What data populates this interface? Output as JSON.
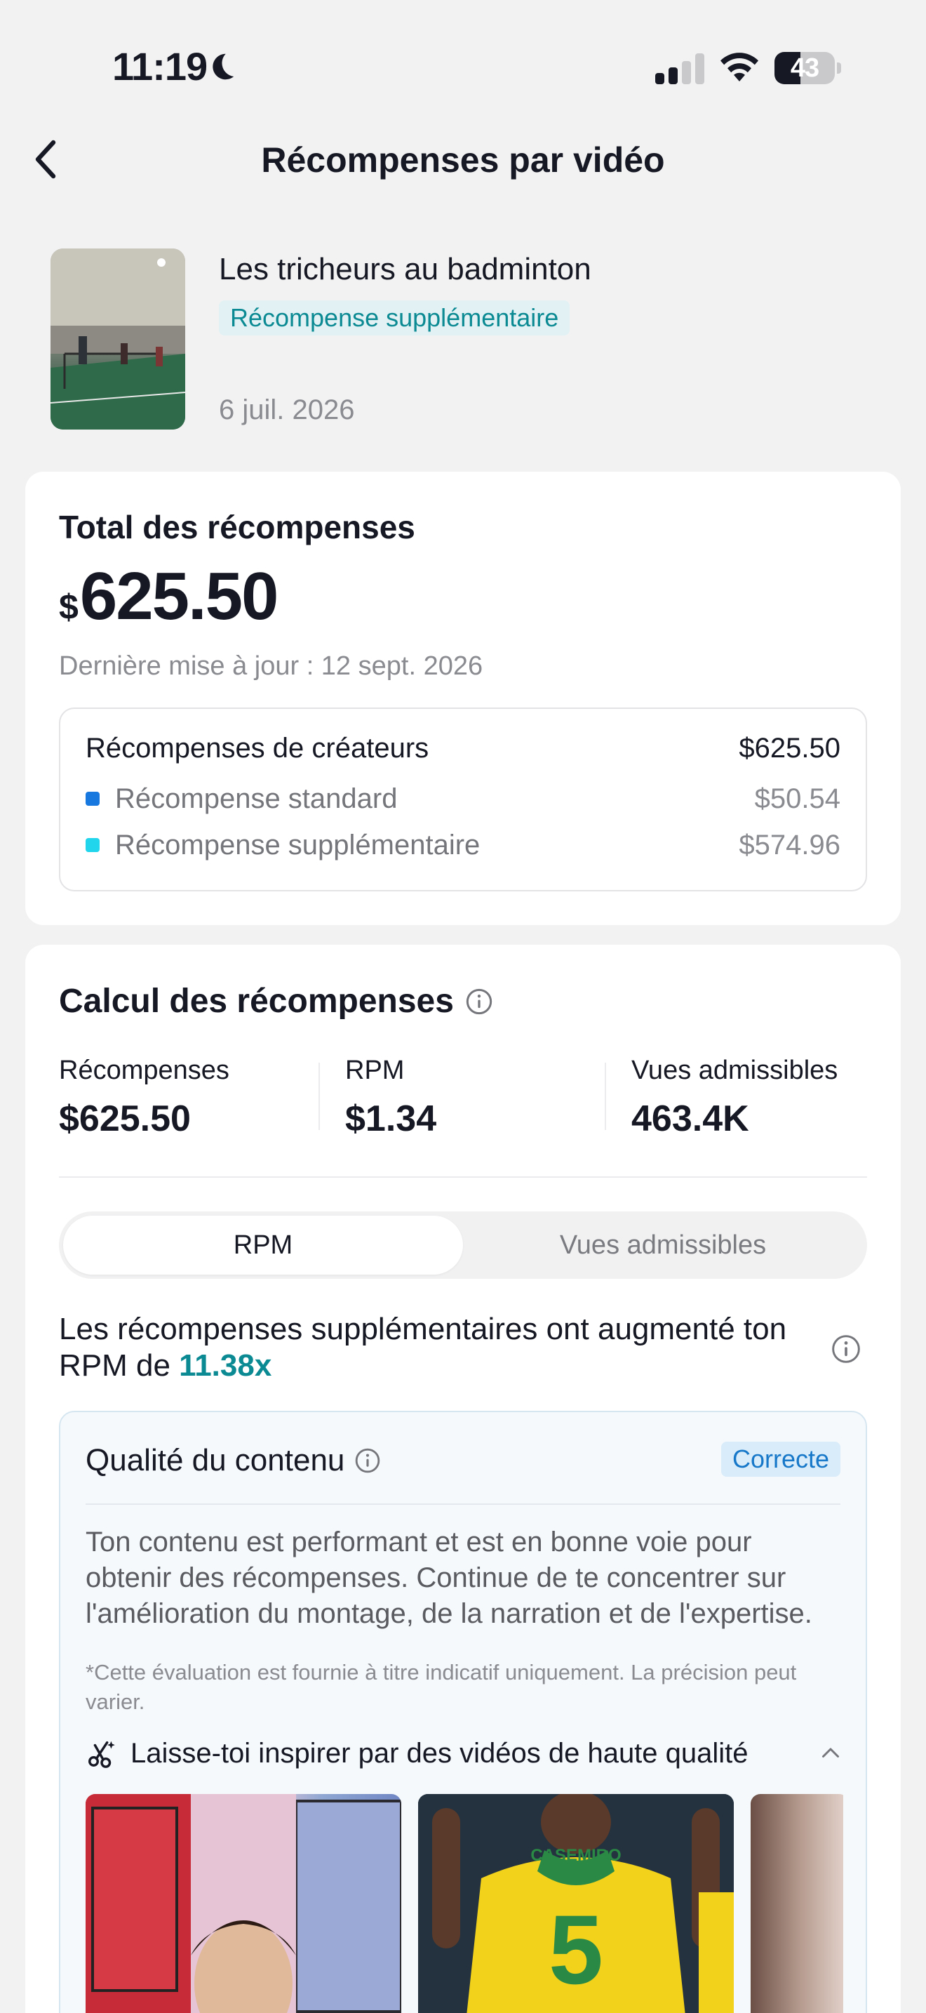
{
  "status_bar": {
    "time": "11:19",
    "battery": "43",
    "battery_level": 0.43
  },
  "nav": {
    "title": "Récompenses par vidéo"
  },
  "video": {
    "title": "Les tricheurs au badminton",
    "badge": "Récompense supplémentaire",
    "date": "6 juil. 2026"
  },
  "totals": {
    "label": "Total des récompenses",
    "currency": "$",
    "amount": "625.50",
    "updated": "Dernière mise à jour : 12 sept. 2026",
    "breakdown": {
      "head_label": "Récompenses de créateurs",
      "head_value": "$625.50",
      "rows": [
        {
          "label": "Récompense standard",
          "value": "$50.54",
          "color": "#1778e0"
        },
        {
          "label": "Récompense supplémentaire",
          "value": "$574.96",
          "color": "#20d5ec"
        }
      ]
    }
  },
  "calc": {
    "title": "Calcul des récompenses",
    "stats": [
      {
        "label": "Récompenses",
        "value": "$625.50"
      },
      {
        "label": "RPM",
        "value": "$1.34"
      },
      {
        "label": "Vues admissibles",
        "value": "463.4K"
      }
    ],
    "tabs": [
      {
        "label": "RPM",
        "active": true
      },
      {
        "label": "Vues admissibles",
        "active": false
      }
    ],
    "message_part1": "Les récompenses supplémentaires ont augmenté ton RPM de ",
    "message_multiplier": "11.38x",
    "quality": {
      "title": "Qualité du contenu",
      "badge": "Correcte",
      "text": "Ton contenu est performant et est en bonne voie pour obtenir des récompenses. Continue de te concentrer sur l'amélioration du montage, de la narration et de l'expertise.",
      "note": "*Cette évaluation est fournie à titre indicatif uniquement. La précision peut varier.",
      "inspire": "Laisse-toi inspirer par des vidéos de haute qualité"
    }
  },
  "colors": {
    "accent_teal": "#0b8a93",
    "accent_blue": "#1778c9"
  }
}
